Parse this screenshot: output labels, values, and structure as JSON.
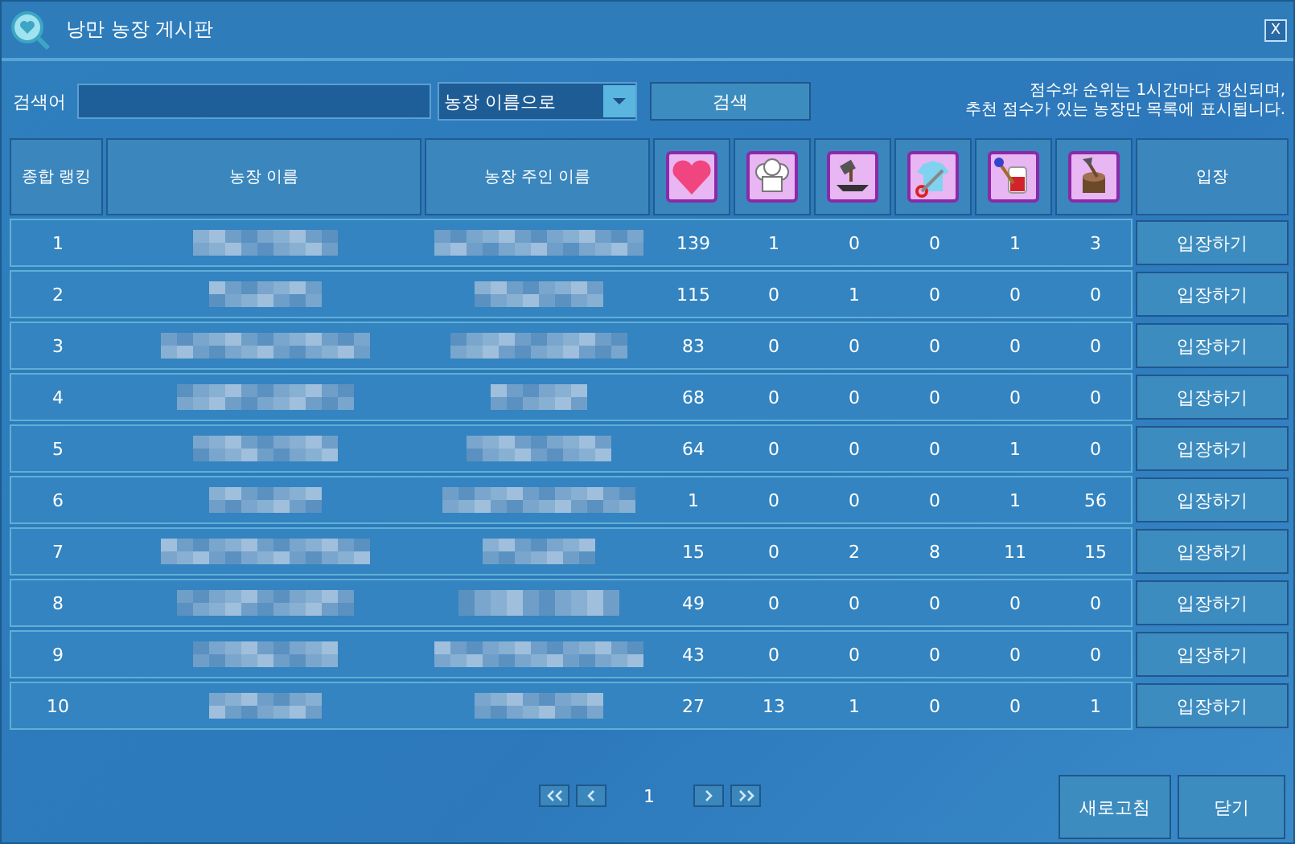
{
  "window": {
    "title": "낭만 농장 게시판",
    "close": "X"
  },
  "search": {
    "label": "검색어",
    "dropdown": "농장 이름으로",
    "button": "검색",
    "notice": [
      "점수와 순위는 1시간마다 갱신되며,",
      "추천 점수가 있는 농장만 목록에 표시됩니다."
    ]
  },
  "table": {
    "columns": [
      {
        "kind": "text",
        "label": "종합 랭킹"
      },
      {
        "kind": "text",
        "label": "농장 이름"
      },
      {
        "kind": "text",
        "label": "농장 주인 이름"
      },
      {
        "kind": "icon"
      },
      {
        "kind": "icon"
      },
      {
        "kind": "icon"
      },
      {
        "kind": "icon"
      },
      {
        "kind": "icon"
      },
      {
        "kind": "icon"
      },
      {
        "kind": "text",
        "label": "입장"
      }
    ],
    "rows": [
      {
        "rank": "1",
        "scores": [
          "139",
          "1",
          "0",
          "0",
          "1",
          "3"
        ],
        "button": "입장하기"
      },
      {
        "rank": "2",
        "scores": [
          "115",
          "0",
          "1",
          "0",
          "0",
          "0"
        ],
        "button": "입장하기"
      },
      {
        "rank": "3",
        "scores": [
          "83",
          "0",
          "0",
          "0",
          "0",
          "0"
        ],
        "button": "입장하기"
      },
      {
        "rank": "4",
        "scores": [
          "68",
          "0",
          "0",
          "0",
          "0",
          "0"
        ],
        "button": "입장하기"
      },
      {
        "rank": "5",
        "scores": [
          "64",
          "0",
          "0",
          "0",
          "1",
          "0"
        ],
        "button": "입장하기"
      },
      {
        "rank": "6",
        "scores": [
          "1",
          "0",
          "0",
          "0",
          "1",
          "56"
        ],
        "button": "입장하기"
      },
      {
        "rank": "7",
        "scores": [
          "15",
          "0",
          "2",
          "8",
          "11",
          "15"
        ],
        "button": "입장하기"
      },
      {
        "rank": "8",
        "scores": [
          "49",
          "0",
          "0",
          "0",
          "0",
          "0"
        ],
        "button": "입장하기"
      },
      {
        "rank": "9",
        "scores": [
          "43",
          "0",
          "0",
          "0",
          "0",
          "0"
        ],
        "button": "입장하기"
      },
      {
        "rank": "10",
        "scores": [
          "27",
          "13",
          "1",
          "0",
          "0",
          "1"
        ],
        "button": "입장하기"
      }
    ]
  },
  "pagination": {
    "page": "1"
  },
  "buttons": [
    "새로고침",
    "닫기"
  ]
}
